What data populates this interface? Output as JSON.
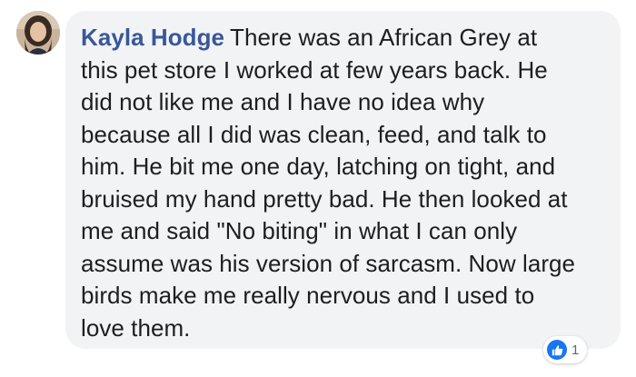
{
  "comment": {
    "author": "Kayla Hodge",
    "text": "There was an African Grey at\nthis pet store I worked at few years back. He\ndid not like me and I have no idea why\nbecause all I did was clean, feed, and talk to\nhim. He bit me one day, latching on tight, and\nbruised my hand pretty bad. He then looked at\nme and said \"No biting\" in what I can only\nassume was his version of sarcasm. Now large\nbirds make me really nervous and I used to\nlove them."
  },
  "reactions": {
    "icon": "like-icon",
    "count": "1"
  },
  "colors": {
    "author": "#385898",
    "bubble": "#f2f3f5",
    "text": "#1c1e21",
    "like": "#1877f2"
  }
}
